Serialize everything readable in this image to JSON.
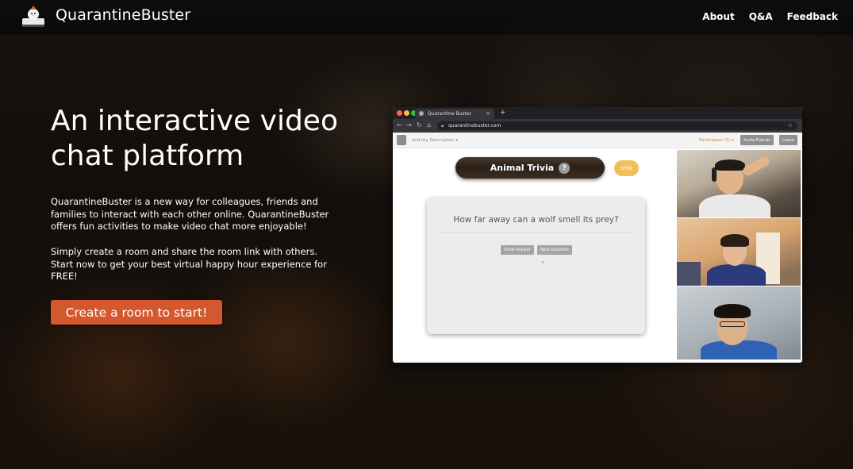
{
  "navbar": {
    "brand": "QuarantineBuster",
    "links": [
      "About",
      "Q&A",
      "Feedback"
    ]
  },
  "hero": {
    "headline": "An interactive video chat platform",
    "paragraph1": "QuarantineBuster is a new way for colleagues, friends and families to interact with each other online. QuarantineBuster offers fun activities to make video chat more enjoyable!",
    "paragraph2": "Simply create a room and share the room link with others. Start now to get your best virtual happy hour experience for FREE!",
    "cta_label": "Create a room to start!"
  },
  "mockup": {
    "tab_title": "Quarantine Buster",
    "url": "quarantinebuster.com",
    "activity_description": "Activity Description ▾",
    "participants": "Participant (3) ▾",
    "invite_label": "Invite Friends",
    "leave_label": "Leave",
    "activity_title": "Animal Trivia",
    "help_glyph": "?",
    "spin_label": "SPIN",
    "question": "How far away can a wolf smell its prey?",
    "show_answer_label": "Show Answer",
    "next_question_label": "Next Question"
  },
  "colors": {
    "cta": "#d4582e",
    "spin": "#f0c15a",
    "participants": "#e08a3a"
  }
}
